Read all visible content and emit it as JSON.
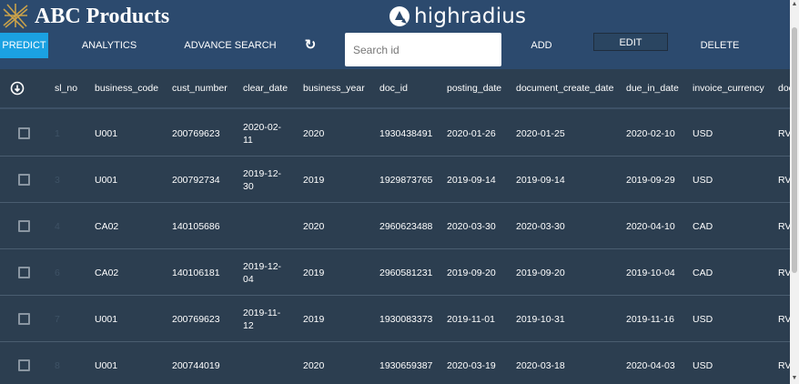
{
  "header": {
    "brand": "ABC Products",
    "partner_logo_text": "highradius"
  },
  "toolbar": {
    "predict_label": "PREDICT",
    "analytics_label": "ANALYTICS",
    "advance_search_label": "ADVANCE SEARCH",
    "refresh_icon": "↻",
    "search_placeholder": "Search id",
    "add_label": "ADD",
    "edit_label": "EDIT",
    "delete_label": "DELETE"
  },
  "colors": {
    "header_bg": "#2c4a6e",
    "accent": "#1ba1e2",
    "grid_bg": "#2c3e50"
  },
  "table": {
    "columns": [
      "sl_no",
      "business_code",
      "cust_number",
      "clear_date",
      "business_year",
      "doc_id",
      "posting_date",
      "document_create_date",
      "due_in_date",
      "invoice_currency",
      "doc"
    ],
    "rows": [
      {
        "sl_no": "1",
        "business_code": "U001",
        "cust_number": "200769623",
        "clear_date": "2020-02-11",
        "business_year": "2020",
        "doc_id": "1930438491",
        "posting_date": "2020-01-26",
        "document_create_date": "2020-01-25",
        "due_in_date": "2020-02-10",
        "invoice_currency": "USD",
        "doc": "RV"
      },
      {
        "sl_no": "3",
        "business_code": "U001",
        "cust_number": "200792734",
        "clear_date": "2019-12-30",
        "business_year": "2019",
        "doc_id": "1929873765",
        "posting_date": "2019-09-14",
        "document_create_date": "2019-09-14",
        "due_in_date": "2019-09-29",
        "invoice_currency": "USD",
        "doc": "RV"
      },
      {
        "sl_no": "4",
        "business_code": "CA02",
        "cust_number": "140105686",
        "clear_date": "",
        "business_year": "2020",
        "doc_id": "2960623488",
        "posting_date": "2020-03-30",
        "document_create_date": "2020-03-30",
        "due_in_date": "2020-04-10",
        "invoice_currency": "CAD",
        "doc": "RV"
      },
      {
        "sl_no": "6",
        "business_code": "CA02",
        "cust_number": "140106181",
        "clear_date": "2019-12-04",
        "business_year": "2019",
        "doc_id": "2960581231",
        "posting_date": "2019-09-20",
        "document_create_date": "2019-09-20",
        "due_in_date": "2019-10-04",
        "invoice_currency": "CAD",
        "doc": "RV"
      },
      {
        "sl_no": "7",
        "business_code": "U001",
        "cust_number": "200769623",
        "clear_date": "2019-11-12",
        "business_year": "2019",
        "doc_id": "1930083373",
        "posting_date": "2019-11-01",
        "document_create_date": "2019-10-31",
        "due_in_date": "2019-11-16",
        "invoice_currency": "USD",
        "doc": "RV"
      },
      {
        "sl_no": "8",
        "business_code": "U001",
        "cust_number": "200744019",
        "clear_date": "",
        "business_year": "2020",
        "doc_id": "1930659387",
        "posting_date": "2020-03-19",
        "document_create_date": "2020-03-18",
        "due_in_date": "2020-04-03",
        "invoice_currency": "USD",
        "doc": "RV"
      }
    ]
  }
}
